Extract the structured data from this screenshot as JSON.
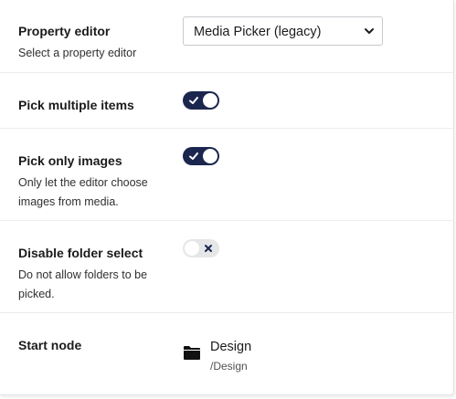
{
  "property_editor": {
    "label": "Property editor",
    "description": "Select a property editor",
    "selected": "Media Picker (legacy)"
  },
  "pick_multiple": {
    "label": "Pick multiple items",
    "checked": true
  },
  "pick_only_images": {
    "label": "Pick only images",
    "description": "Only let the editor choose images from media.",
    "checked": true
  },
  "disable_folder_select": {
    "label": "Disable folder select",
    "description": "Do not allow folders to be picked.",
    "checked": false
  },
  "start_node": {
    "label": "Start node",
    "name": "Design",
    "path": "/Design",
    "icon": "folder-icon"
  },
  "colors": {
    "toggle_on": "#1b264f",
    "toggle_off": "#e6e6e8"
  }
}
